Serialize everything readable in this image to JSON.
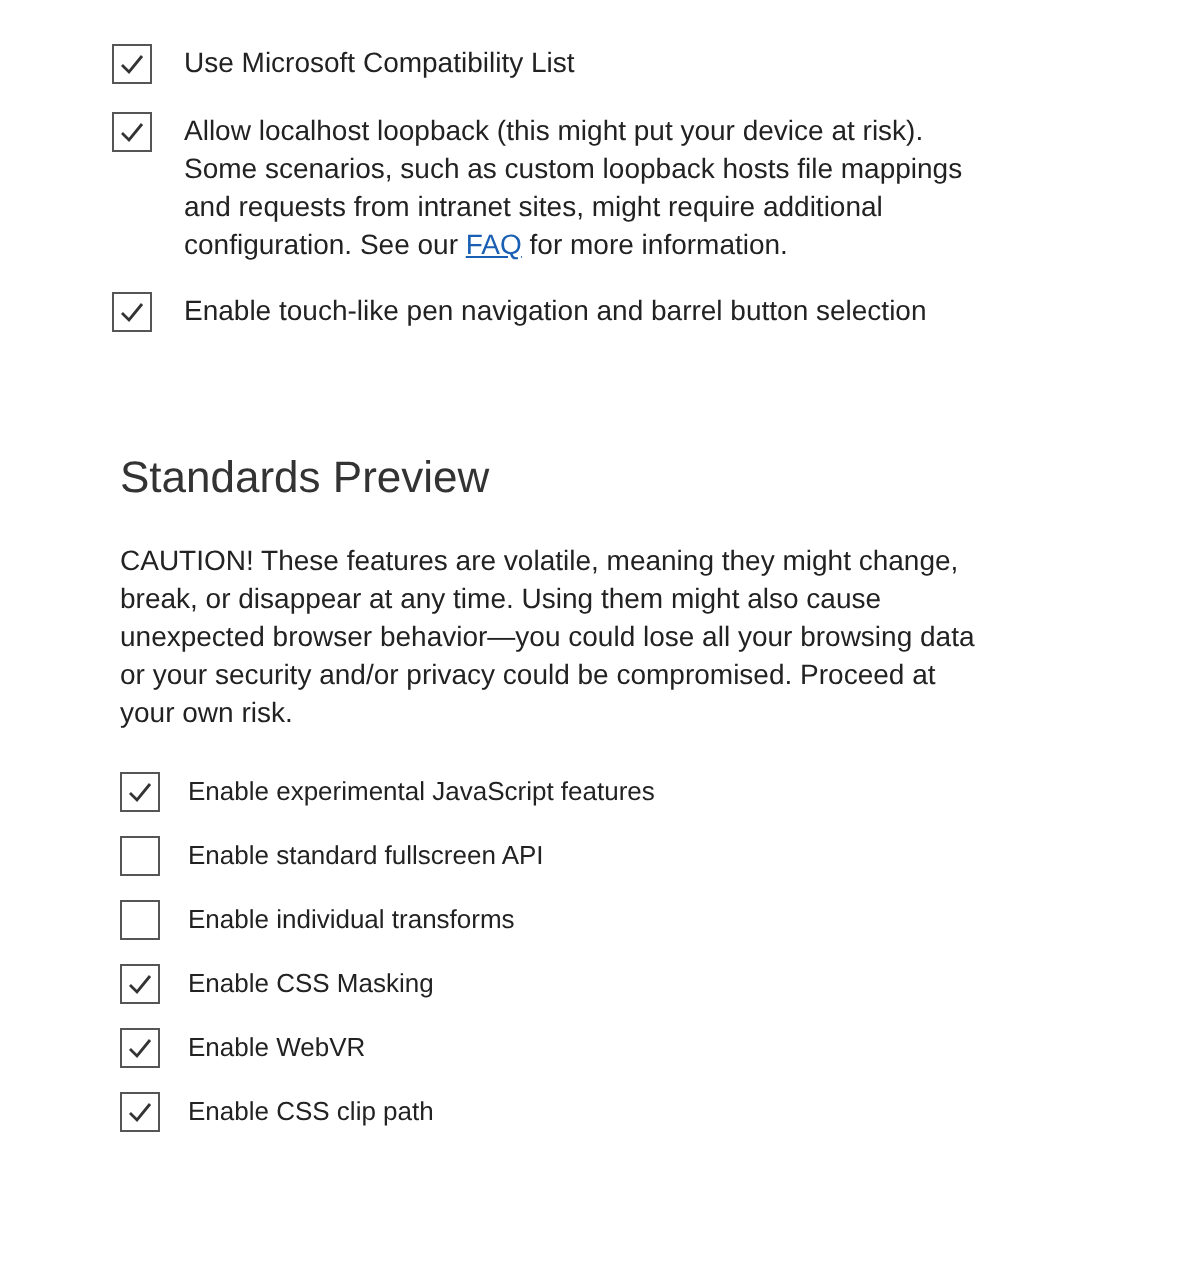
{
  "top_options": [
    {
      "text": "Use Microsoft Compatibility List",
      "checked": true
    },
    {
      "text": "Allow localhost loopback (this might put your device at risk). Some scenarios, such as custom loopback hosts file mappings and requests from intranet sites, might require additional configuration. See our ",
      "link": "FAQ",
      "after": " for more information.",
      "checked": true
    },
    {
      "text": "Enable touch-like pen navigation and barrel button selection",
      "checked": true
    }
  ],
  "standards_preview": {
    "title": "Standards Preview",
    "caution": "CAUTION! These features are volatile, meaning they might change, break, or disappear at any time. Using them might also cause unexpected browser behavior—you could lose all your browsing data or your security and/or privacy could be compromised. Proceed at your own risk.",
    "options": [
      {
        "text": "Enable experimental JavaScript features",
        "checked": true
      },
      {
        "text": "Enable standard fullscreen API",
        "checked": false
      },
      {
        "text": "Enable individual transforms",
        "checked": false
      },
      {
        "text": "Enable CSS Masking",
        "checked": true
      },
      {
        "text": "Enable WebVR",
        "checked": true
      },
      {
        "text": "Enable CSS clip path",
        "checked": true
      }
    ]
  }
}
